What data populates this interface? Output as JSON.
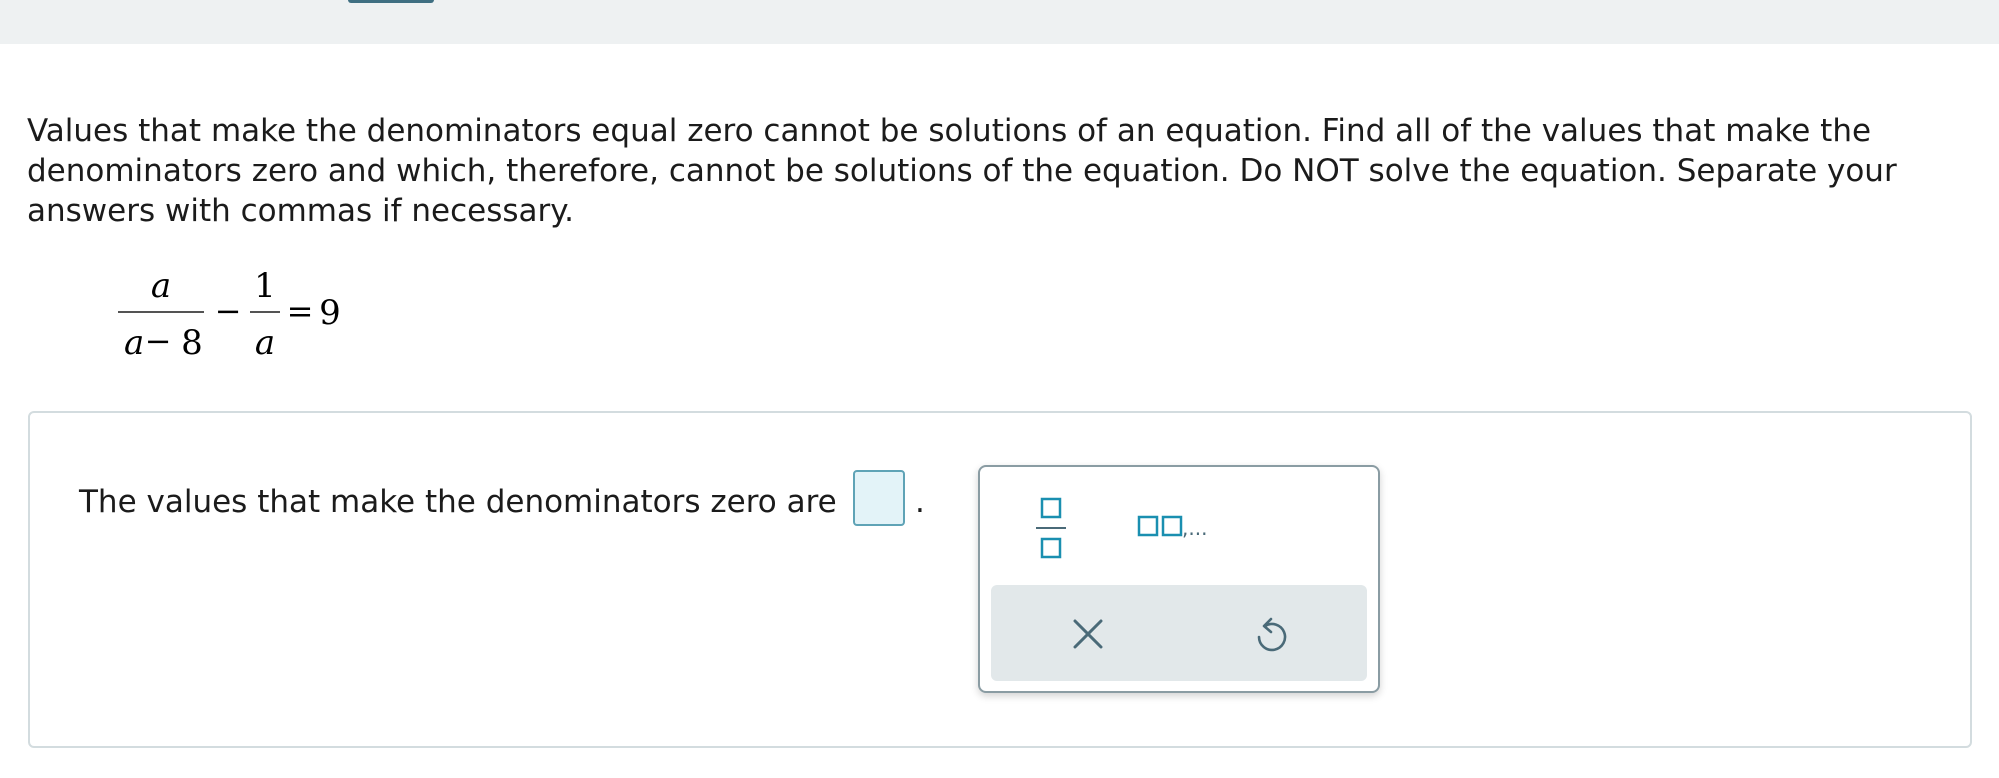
{
  "question": {
    "instructions": "Values that make the denominators equal zero cannot be solutions of an equation. Find all of the values that make the denominators zero and which, therefore, cannot be solutions of the equation. Do NOT solve the equation. Separate your answers with commas if necessary.",
    "equation": {
      "term1": {
        "numerator": "a",
        "denominator_var": "a",
        "denominator_minus": "−",
        "denominator_num": "8"
      },
      "operator": "−",
      "term2": {
        "numerator": "1",
        "denominator": "a"
      },
      "equals": "=",
      "rhs": "9"
    }
  },
  "answer": {
    "prompt": "The values that make the denominators zero are",
    "input_value": "",
    "period": "."
  },
  "palette": {
    "list_ellipsis": ",..."
  },
  "colors": {
    "accent": "#1a8fb0",
    "input_bg": "#e3f3f8",
    "palette_bar": "#e2e8ea",
    "icon_dark": "#4a6a78"
  },
  "icons": [
    "fraction-icon",
    "list-icon",
    "close-icon",
    "undo-icon"
  ]
}
